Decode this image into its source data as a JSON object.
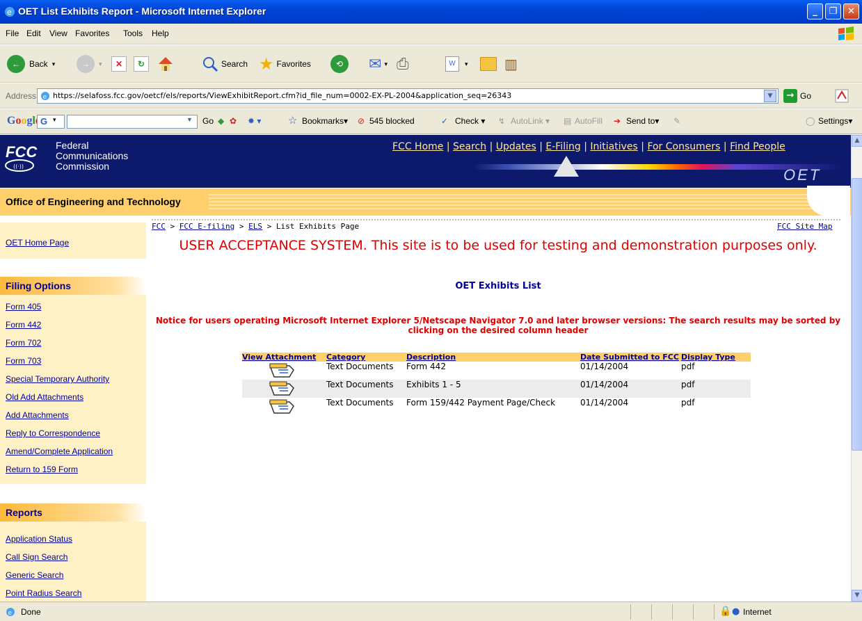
{
  "window": {
    "title": "OET List Exhibits Report - Microsoft Internet Explorer",
    "minimize": "_",
    "maximize": "❐",
    "close": "✕"
  },
  "menu": [
    "File",
    "Edit",
    "View",
    "Favorites",
    "Tools",
    "Help"
  ],
  "toolbar": {
    "back": "Back",
    "search": "Search",
    "favorites": "Favorites"
  },
  "address": {
    "label": "Address",
    "url": "https://selafoss.fcc.gov/oetcf/els/reports/ViewExhibitReport.cfm?id_file_num=0002-EX-PL-2004&application_seq=26343",
    "go": "Go"
  },
  "google_bar": {
    "go": "Go",
    "bookmarks": "Bookmarks▾",
    "blocked": "545 blocked",
    "check": "Check ▾",
    "autolink": "AutoLink ▾",
    "autofill": "AutoFill",
    "send_to": "Send to▾",
    "settings": "Settings▾"
  },
  "fcc": {
    "name_line1": "Federal",
    "name_line2": "Communications",
    "name_line3": "Commission",
    "nav": [
      "FCC Home",
      "Search",
      "Updates",
      "E-Filing",
      "Initiatives",
      "For Consumers",
      "Find People"
    ],
    "oet_mark": "OET",
    "office_title": "Office of Engineering and Technology"
  },
  "sidebar": {
    "home_link": "OET Home Page",
    "filing_head": "Filing Options",
    "filing_links": [
      "Form 405",
      "Form 442",
      "Form 702",
      "Form 703",
      "Special Temporary Authority",
      "Old Add Attachments",
      "Add Attachments",
      "Reply to Correspondence",
      "Amend/Complete Application",
      "Return to 159 Form"
    ],
    "reports_head": "Reports",
    "report_links": [
      "Application Status",
      "Call Sign Search",
      "Generic Search",
      "Point Radius Search"
    ]
  },
  "breadcrumb": {
    "fcc": "FCC",
    "efiling": "FCC E-filing",
    "els": "ELS",
    "current": "List Exhibits Page",
    "sitemap": "FCC Site Map"
  },
  "banner": "USER ACCEPTANCE SYSTEM. This site is to be used for testing and demonstration purposes only.",
  "list_title": "OET Exhibits List",
  "notice": "Notice for users operating Microsoft Internet Explorer 5/Netscape Navigator 7.0 and later browser versions: The search results may be sorted by clicking on the desired column header",
  "table": {
    "headers": [
      "View Attachment",
      "Category",
      "Description",
      "Date Submitted to FCC",
      "Display Type"
    ],
    "rows": [
      {
        "category": "Text Documents",
        "description": "Form 442",
        "date": "01/14/2004",
        "type": "pdf"
      },
      {
        "category": "Text Documents",
        "description": "Exhibits 1 - 5",
        "date": "01/14/2004",
        "type": "pdf"
      },
      {
        "category": "Text Documents",
        "description": "Form 159/442 Payment Page/Check",
        "date": "01/14/2004",
        "type": "pdf"
      }
    ]
  },
  "status": {
    "text": "Done",
    "zone": "Internet"
  }
}
